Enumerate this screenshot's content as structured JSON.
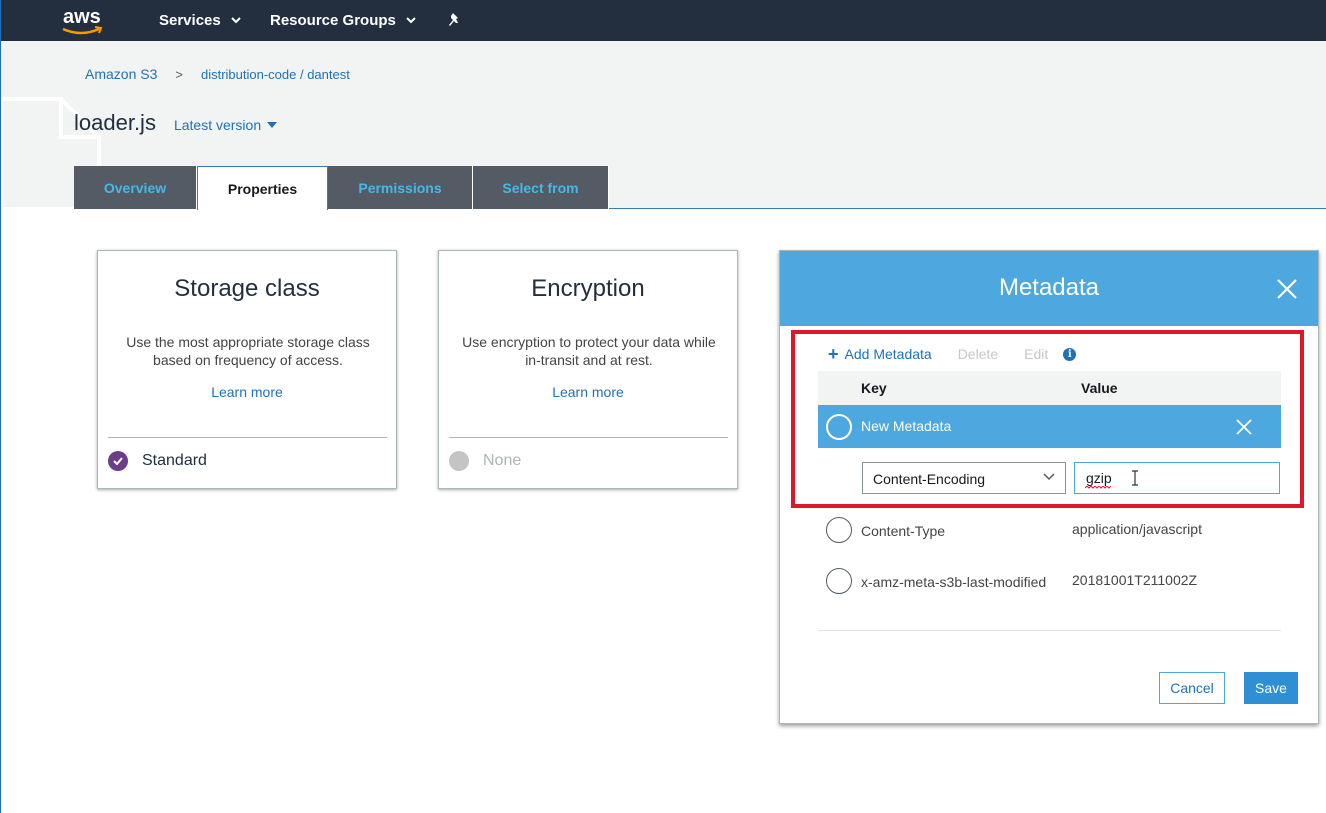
{
  "topnav": {
    "logo_text": "aws",
    "services_label": "Services",
    "resource_groups_label": "Resource Groups",
    "bg_color": "#232f3e"
  },
  "breadcrumb": {
    "root": "Amazon S3",
    "separator": ">",
    "path": "distribution-code / dantest"
  },
  "object": {
    "title": "loader.js",
    "version_label": "Latest version"
  },
  "tabs": [
    {
      "label": "Overview",
      "active": false
    },
    {
      "label": "Properties",
      "active": true
    },
    {
      "label": "Permissions",
      "active": false
    },
    {
      "label": "Select from",
      "active": false
    }
  ],
  "cards": {
    "storage": {
      "title": "Storage class",
      "description": "Use the most appropriate storage class based on frequency of access.",
      "learn_more": "Learn more",
      "value": "Standard"
    },
    "encryption": {
      "title": "Encryption",
      "description": "Use encryption to protect your data while in-transit and at rest.",
      "learn_more": "Learn more",
      "value": "None"
    }
  },
  "metadata_modal": {
    "title": "Metadata",
    "header_color": "#4ca8de",
    "toolbar": {
      "add_label": "Add Metadata",
      "delete_label": "Delete",
      "edit_label": "Edit"
    },
    "columns": {
      "key": "Key",
      "value": "Value"
    },
    "new_row_label": "New Metadata",
    "new_key_selected": "Content-Encoding",
    "new_value": "gzip",
    "rows": [
      {
        "key": "Content-Type",
        "value": "application/javascript"
      },
      {
        "key": "x-amz-meta-s3b-last-modified",
        "value": "20181001T211002Z"
      }
    ],
    "cancel_label": "Cancel",
    "save_label": "Save",
    "highlight_color": "#e0162b"
  }
}
